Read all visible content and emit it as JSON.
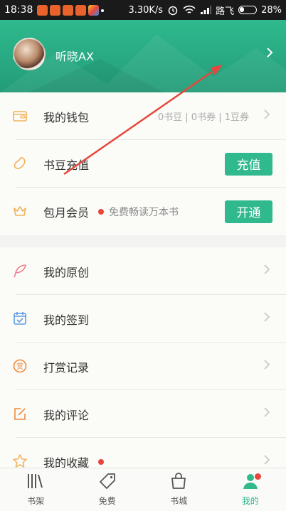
{
  "status_bar": {
    "time": "18:38",
    "network_speed": "3.30K/s",
    "carrier": "路飞",
    "battery": "28%"
  },
  "profile": {
    "username": "听晓AX"
  },
  "wallet": {
    "label": "我的钱包",
    "info": "0书豆 | 0书券 | 1豆券"
  },
  "recharge": {
    "label": "书豆充值",
    "button": "充值"
  },
  "membership": {
    "label": "包月会员",
    "description": "免费畅读万本书",
    "button": "开通"
  },
  "menu": [
    {
      "label": "我的原创"
    },
    {
      "label": "我的签到"
    },
    {
      "label": "打赏记录"
    },
    {
      "label": "我的评论"
    },
    {
      "label": "我的收藏"
    }
  ],
  "bottom_nav": [
    {
      "label": "书架"
    },
    {
      "label": "免费"
    },
    {
      "label": "书城"
    },
    {
      "label": "我的"
    }
  ],
  "colors": {
    "accent": "#2fb98d",
    "badge": "#e8463c",
    "annotation_arrow": "#e8463c"
  }
}
